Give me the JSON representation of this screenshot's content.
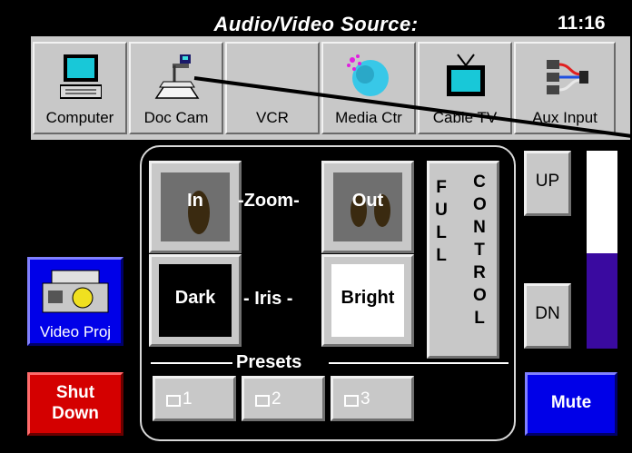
{
  "header": {
    "title": "Audio/Video Source:",
    "time": "11:16"
  },
  "sources": [
    {
      "label": "Computer",
      "icon": "computer-icon"
    },
    {
      "label": "Doc Cam",
      "icon": "document-camera-icon"
    },
    {
      "label": "VCR",
      "icon": ""
    },
    {
      "label": "Media Ctr",
      "icon": "media-center-icon"
    },
    {
      "label": "Cable TV",
      "icon": "television-icon"
    },
    {
      "label": "Aux Input",
      "icon": "aux-input-icon"
    }
  ],
  "camera": {
    "zoom_in": "In",
    "zoom_label": "-Zoom-",
    "zoom_out": "Out",
    "iris_dark": "Dark",
    "iris_label": "- Iris -",
    "iris_bright": "Bright",
    "full_control_col1": [
      "F",
      "U",
      "L",
      "L"
    ],
    "full_control_col2": [
      "C",
      "O",
      "N",
      "T",
      "R",
      "O",
      "L"
    ],
    "presets_label": "Presets",
    "presets": [
      "1",
      "2",
      "3"
    ]
  },
  "volume": {
    "up": "UP",
    "down": "DN",
    "mute": "Mute",
    "level": 0.48,
    "level_color": "#3a0aa0",
    "empty_color": "#ffffff"
  },
  "left": {
    "video_proj": "Video Proj",
    "shutdown_line1": "Shut",
    "shutdown_line2": "Down"
  },
  "colors": {
    "red": "#d40000",
    "blue": "#0000e8",
    "gray": "#c8c8c8"
  }
}
